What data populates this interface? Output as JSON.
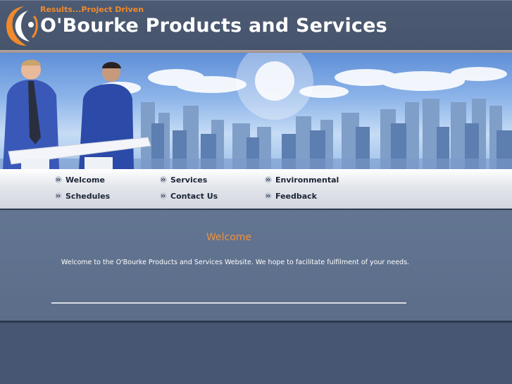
{
  "header": {
    "tagline": "Results...Project Driven",
    "title": "O'Bourke Products and Services",
    "logo_icon": "orange-swirl-logo"
  },
  "banner": {
    "description_icon": "business-men-city-skyline-banner"
  },
  "nav": {
    "items": [
      {
        "label": "Welcome"
      },
      {
        "label": "Services"
      },
      {
        "label": "Environmental"
      },
      {
        "label": "Schedules"
      },
      {
        "label": "Contact Us"
      },
      {
        "label": "Feedback"
      }
    ]
  },
  "main": {
    "title": "Welcome",
    "text": "Welcome to the O'Bourke Products and Services Website. We hope to facilitate fulfilment of your needs."
  },
  "colors": {
    "header_bg": "#4c5a73",
    "accent_orange": "#f08a2c",
    "content_bg": "#627592",
    "nav_text": "#1c2535"
  }
}
